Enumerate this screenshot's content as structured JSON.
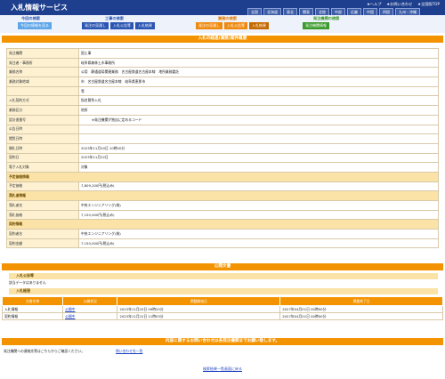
{
  "header": {
    "title": "入札情報サービス",
    "links": [
      "★ヘルプ",
      "★お問い合わせ",
      "★全国版TOP"
    ],
    "regions": [
      "全国",
      "北海道",
      "東北",
      "関東",
      "北陸",
      "中部",
      "近畿",
      "中国",
      "四国",
      "九州・沖縄"
    ]
  },
  "groups": {
    "cert": {
      "title": "今回の検索",
      "tabs": [
        "今回の情報を見る"
      ]
    },
    "construction": {
      "title": "工事の検索",
      "tabs": [
        "発注の見通し",
        "入札公告等",
        "入札結果"
      ]
    },
    "service": {
      "title": "業務の検索",
      "tabs": [
        "発注の見通し",
        "入札公告等",
        "入札結果"
      ]
    },
    "other": {
      "title": "発注機関の検索",
      "tabs": [
        "発注機関情報"
      ]
    }
  },
  "detail": {
    "title": "入札の経過(業務)案件概要",
    "rows": [
      {
        "label": "発注機関",
        "value": "国土事"
      },
      {
        "label": "発注者・事務所",
        "value": "岐阜県森林土木事務所"
      },
      {
        "label": "業務名称",
        "value": "公用　静通道局関連業務　名古屋鉄道名古屋本線　地所業務委託"
      },
      {
        "label": "業務対象地域",
        "value": "市　名古屋鉄道名古屋本線　岐阜県恵那市"
      },
      {
        "label": "",
        "value": "等"
      },
      {
        "label": "入札契約方式",
        "value": "指名競争入札"
      },
      {
        "label": "業務区分",
        "value": "地所"
      },
      {
        "label": "設計書番号",
        "value": "※発注機関が独自に定めるコード"
      },
      {
        "label": "公告日時",
        "value": ""
      },
      {
        "label": "閲覧日時",
        "value": ""
      },
      {
        "label": "開札日時",
        "value": "2023年11月20日 10時00分"
      },
      {
        "label": "契約日",
        "value": "2023年11月22日"
      },
      {
        "label": "電子入札対象",
        "value": "対象"
      }
    ],
    "price_section": "予定価格情報",
    "price_rows": [
      {
        "label": "予定価格",
        "value": "7,809,200円(税込み)"
      }
    ],
    "winner_section": "落札者情報",
    "winner_rows": [
      {
        "label": "落札者名",
        "value": "中央エンジニアリング(株)"
      },
      {
        "label": "落札価格",
        "value": "7,150,000円(税込み)"
      }
    ],
    "contract_section": "契約情報",
    "contract_rows": [
      {
        "label": "契約者名",
        "value": "中央エンジニアリング(株)"
      },
      {
        "label": "契約金額",
        "value": "7,150,000円(税込み)"
      }
    ]
  },
  "notices": {
    "title": "公開文書",
    "sub_title": "入札公告等",
    "empty": "該当データはありません"
  },
  "history": {
    "sub_title": "入札経過",
    "columns": [
      "文書名称",
      "公開状況",
      "掲載開始日",
      "掲載終了日"
    ],
    "rows": [
      {
        "name": "入札情報",
        "status": "公開中",
        "start": "2023年11月20日 09時20分",
        "end": "2027年04月01日 00時00分"
      },
      {
        "name": "契約情報",
        "status": "公開中",
        "start": "2023年11月22日 11時03分",
        "end": "2027年04月01日 00時00分"
      }
    ]
  },
  "contact": {
    "bar": "内容に関するお問い合わせは各発注機関までお願い致します。",
    "text": "発注機関への連絡先等はこちらからご確認ください。",
    "link": "問い合わせ先一覧"
  },
  "footer": {
    "back": "検索結果一覧画面に戻る"
  }
}
